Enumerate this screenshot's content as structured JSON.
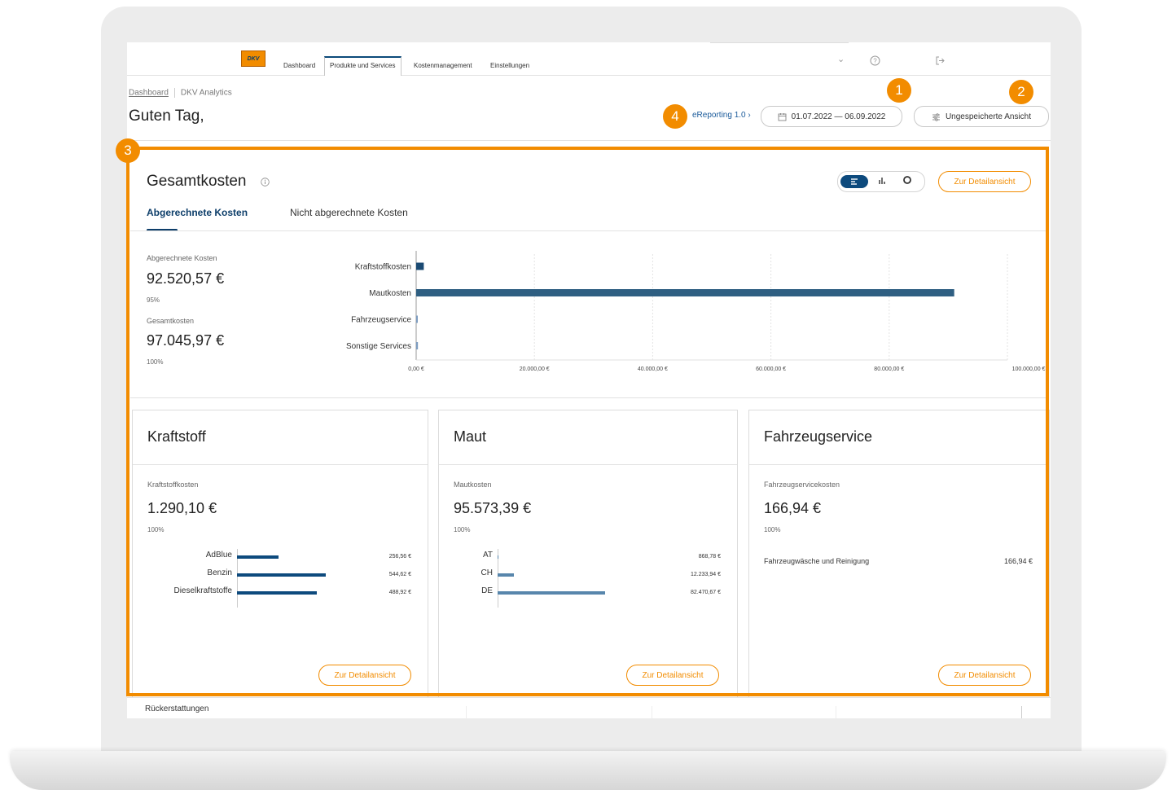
{
  "nav": {
    "logo_text": "DKV",
    "items": [
      {
        "label": "Dashboard"
      },
      {
        "label": "Produkte und Services",
        "active": true
      },
      {
        "label": "Kostenmanagement"
      },
      {
        "label": "Einstellungen"
      }
    ],
    "icons": [
      "chevron-down-icon",
      "help-icon",
      "logout-icon"
    ]
  },
  "breadcrumb": {
    "home": "Dashboard",
    "current": "DKV Analytics"
  },
  "header": {
    "greeting": "Guten Tag,",
    "ereporting_link": "eReporting 1.0 ›",
    "date_range": "01.07.2022 — 06.09.2022",
    "view_label": "Ungespeicherte Ansicht"
  },
  "badges": [
    "1",
    "2",
    "3",
    "4"
  ],
  "overview": {
    "title": "Gesamtkosten",
    "detail_button": "Zur Detailansicht",
    "tabs": [
      "Abgerechnete Kosten",
      "Nicht abgerechnete Kosten"
    ],
    "kpis": [
      {
        "label": "Abgerechnete Kosten",
        "value": "92.520,57 €",
        "pct": "95%"
      },
      {
        "label": "Gesamtkosten",
        "value": "97.045,97 €",
        "pct": "100%"
      }
    ]
  },
  "chart_data": [
    {
      "type": "bar",
      "orientation": "horizontal",
      "categories": [
        "Kraftstoffkosten",
        "Mautkosten",
        "Fahrzeugservice",
        "Sonstige Services"
      ],
      "values": [
        1290.1,
        91000,
        166.94,
        300
      ],
      "xlim": [
        0,
        100000
      ],
      "xticks": [
        "0,00 €",
        "20.000,00 €",
        "40.000,00 €",
        "60.000,00 €",
        "80.000,00 €",
        "100.000,00 €"
      ],
      "colors": [
        "#1b4a73",
        "#2f5f82",
        "#7d9cc0",
        "#7d9cc0"
      ],
      "grid": true
    }
  ],
  "cards": [
    {
      "title": "Kraftstoff",
      "label": "Kraftstoffkosten",
      "value": "1.290,10 €",
      "pct": "100%",
      "items": [
        {
          "label": "AdBlue",
          "value_text": "256,56 €",
          "value": 256.56
        },
        {
          "label": "Benzin",
          "value_text": "544,62 €",
          "value": 544.62
        },
        {
          "label": "Dieselkraftstoffe",
          "value_text": "488,92 €",
          "value": 488.92
        }
      ],
      "bar_color": "#0d4a7d",
      "button": "Zur Detailansicht"
    },
    {
      "title": "Maut",
      "label": "Mautkosten",
      "value": "95.573,39 €",
      "pct": "100%",
      "items": [
        {
          "label": "AT",
          "value_text": "868,78 €",
          "value": 868.78
        },
        {
          "label": "CH",
          "value_text": "12.233,94 €",
          "value": 12233.94
        },
        {
          "label": "DE",
          "value_text": "82.470,67 €",
          "value": 82470.67
        }
      ],
      "bar_color": "#5886ac",
      "button": "Zur Detailansicht"
    },
    {
      "title": "Fahrzeugservice",
      "label": "Fahrzeugservicekosten",
      "value": "166,94 €",
      "pct": "100%",
      "row_label": "Fahrzeugwäsche und Reinigung",
      "row_value": "166,94 €",
      "button": "Zur Detailansicht"
    }
  ],
  "bottom": {
    "label": "Rückerstattungen"
  },
  "colors": {
    "accent": "#f28c00",
    "primary": "#0d4a7d"
  }
}
